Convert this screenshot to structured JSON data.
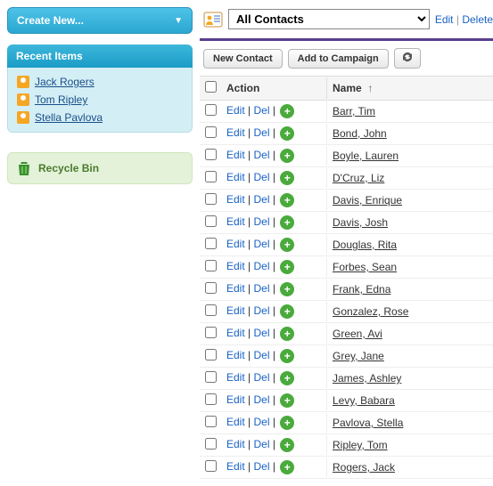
{
  "left": {
    "create_label": "Create New...",
    "recent_header": "Recent Items",
    "recent_items": [
      {
        "name": "Jack Rogers"
      },
      {
        "name": "Tom Ripley"
      },
      {
        "name": "Stella Pavlova"
      }
    ],
    "recycle_label": "Recycle Bin"
  },
  "topbar": {
    "view_selected": "All Contacts",
    "edit_label": "Edit",
    "delete_label": "Delete"
  },
  "toolbar": {
    "new_contact": "New Contact",
    "add_to_campaign": "Add to Campaign"
  },
  "table": {
    "col_action": "Action",
    "col_name": "Name",
    "sort_indicator": "↑",
    "edit_label": "Edit",
    "del_label": "Del",
    "rows": [
      {
        "name": "Barr, Tim"
      },
      {
        "name": "Bond, John"
      },
      {
        "name": "Boyle, Lauren"
      },
      {
        "name": "D'Cruz, Liz"
      },
      {
        "name": "Davis, Enrique"
      },
      {
        "name": "Davis, Josh"
      },
      {
        "name": "Douglas, Rita"
      },
      {
        "name": "Forbes, Sean"
      },
      {
        "name": "Frank, Edna"
      },
      {
        "name": "Gonzalez, Rose"
      },
      {
        "name": "Green, Avi"
      },
      {
        "name": "Grey, Jane"
      },
      {
        "name": "James, Ashley"
      },
      {
        "name": "Levy, Babara"
      },
      {
        "name": "Pavlova, Stella"
      },
      {
        "name": "Ripley, Tom"
      },
      {
        "name": "Rogers, Jack"
      }
    ]
  }
}
